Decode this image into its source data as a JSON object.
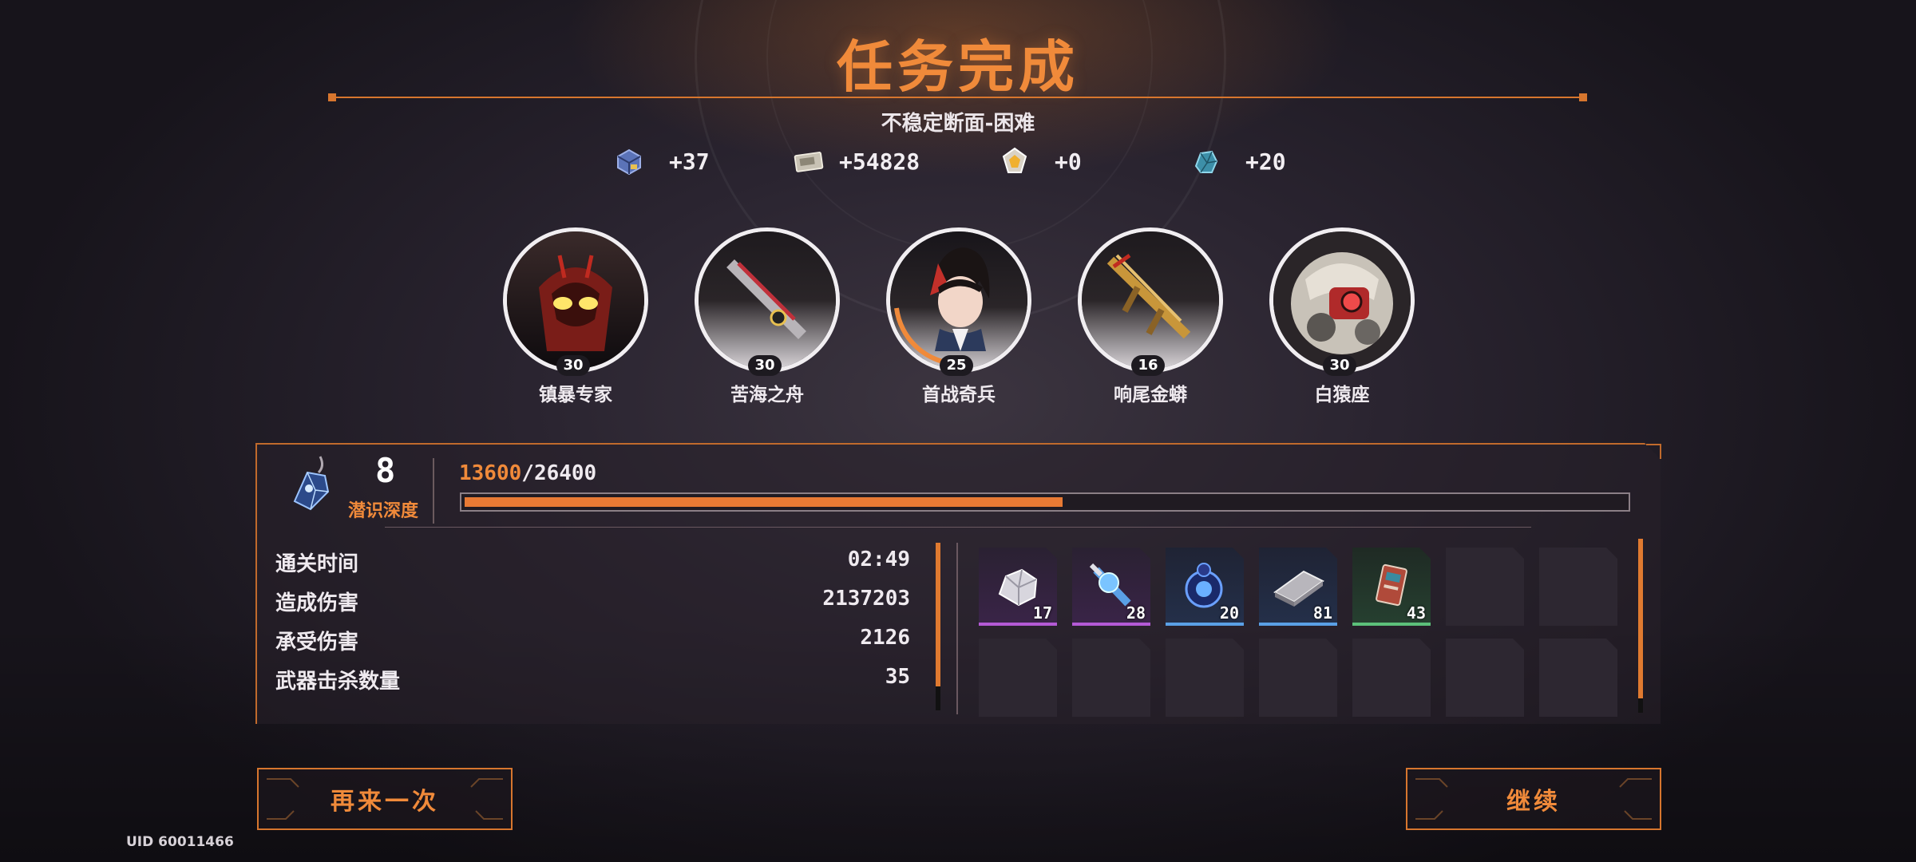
{
  "title": "任务完成",
  "subtitle": "不稳定断面-困难",
  "currencies": [
    {
      "icon": "blue-chest-icon",
      "value": "+37"
    },
    {
      "icon": "silver-ticket-icon",
      "value": "+54828"
    },
    {
      "icon": "gold-crystal-icon",
      "value": "+0"
    },
    {
      "icon": "cyan-ore-icon",
      "value": "+20"
    }
  ],
  "characters": [
    {
      "name": "镇暴专家",
      "level": "30",
      "icon": "red-mech-portrait"
    },
    {
      "name": "苦海之舟",
      "level": "30",
      "icon": "rifle-weapon-portrait"
    },
    {
      "name": "首战奇兵",
      "level": "25",
      "icon": "red-hair-character-portrait"
    },
    {
      "name": "响尾金蟒",
      "level": "16",
      "icon": "gold-rifle-weapon-portrait"
    },
    {
      "name": "白猿座",
      "level": "30",
      "icon": "white-mech-portrait"
    }
  ],
  "depth": {
    "level": "8",
    "label": "潜识深度",
    "xp_current": "13600",
    "xp_separator": "/",
    "xp_total": "26400",
    "progress": 0.515
  },
  "stats": [
    {
      "label": "通关时间",
      "value": "02:49"
    },
    {
      "label": "造成伤害",
      "value": "2137203"
    },
    {
      "label": "承受伤害",
      "value": "2126"
    },
    {
      "label": "武器击杀数量",
      "value": "35"
    }
  ],
  "rewards": [
    {
      "icon": "silver-ore-icon",
      "qty": "17",
      "rarity": "purple"
    },
    {
      "icon": "blue-vial-icon",
      "qty": "28",
      "rarity": "purple"
    },
    {
      "icon": "blue-orb-icon",
      "qty": "20",
      "rarity": "blue"
    },
    {
      "icon": "metal-plate-icon",
      "qty": "81",
      "rarity": "blue"
    },
    {
      "icon": "data-card-icon",
      "qty": "43",
      "rarity": "green"
    }
  ],
  "colors": {
    "accent": "#f08a3a",
    "purple": "#b45ad6",
    "blue": "#5aa0e6",
    "green": "#5cc07a"
  },
  "buttons": {
    "retry": "再来一次",
    "continue": "继续"
  },
  "uid": "UID 60011466"
}
